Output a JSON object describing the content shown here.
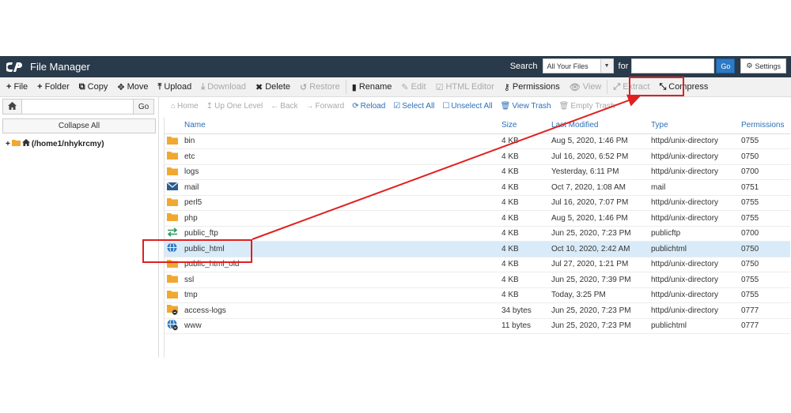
{
  "header": {
    "app_title": "File Manager",
    "search_label": "Search",
    "search_scope": "All Your Files",
    "for_label": "for",
    "search_value": "",
    "go_label": "Go",
    "settings_label": "Settings"
  },
  "toolbar": {
    "file": "File",
    "folder": "Folder",
    "copy": "Copy",
    "move": "Move",
    "upload": "Upload",
    "download": "Download",
    "delete": "Delete",
    "restore": "Restore",
    "rename": "Rename",
    "edit": "Edit",
    "html_editor": "HTML Editor",
    "permissions": "Permissions",
    "view": "View",
    "extract": "Extract",
    "compress": "Compress"
  },
  "left": {
    "go_label": "Go",
    "collapse_all": "Collapse All",
    "root_label": "(/home1/nhykrcmy)"
  },
  "nav": {
    "home": "Home",
    "up_one_level": "Up One Level",
    "back": "Back",
    "forward": "Forward",
    "reload": "Reload",
    "select_all": "Select All",
    "unselect_all": "Unselect All",
    "view_trash": "View Trash",
    "empty_trash": "Empty Trash"
  },
  "table": {
    "headers": {
      "name": "Name",
      "size": "Size",
      "last_modified": "Last Modified",
      "type": "Type",
      "permissions": "Permissions"
    },
    "rows": [
      {
        "icon": "folder-icon",
        "name": "bin",
        "size": "4 KB",
        "modified": "Aug 5, 2020, 1:46 PM",
        "type": "httpd/unix-directory",
        "perm": "0755"
      },
      {
        "icon": "folder-icon",
        "name": "etc",
        "size": "4 KB",
        "modified": "Jul 16, 2020, 6:52 PM",
        "type": "httpd/unix-directory",
        "perm": "0750"
      },
      {
        "icon": "folder-icon",
        "name": "logs",
        "size": "4 KB",
        "modified": "Yesterday, 6:11 PM",
        "type": "httpd/unix-directory",
        "perm": "0700"
      },
      {
        "icon": "mail-icon",
        "name": "mail",
        "size": "4 KB",
        "modified": "Oct 7, 2020, 1:08 AM",
        "type": "mail",
        "perm": "0751"
      },
      {
        "icon": "folder-icon",
        "name": "perl5",
        "size": "4 KB",
        "modified": "Jul 16, 2020, 7:07 PM",
        "type": "httpd/unix-directory",
        "perm": "0755"
      },
      {
        "icon": "folder-icon",
        "name": "php",
        "size": "4 KB",
        "modified": "Aug 5, 2020, 1:46 PM",
        "type": "httpd/unix-directory",
        "perm": "0755"
      },
      {
        "icon": "transfer-icon",
        "name": "public_ftp",
        "size": "4 KB",
        "modified": "Jun 25, 2020, 7:23 PM",
        "type": "publicftp",
        "perm": "0700"
      },
      {
        "icon": "globe-icon",
        "name": "public_html",
        "size": "4 KB",
        "modified": "Oct 10, 2020, 2:42 AM",
        "type": "publichtml",
        "perm": "0750",
        "selected": true
      },
      {
        "icon": "folder-icon",
        "name": "public_html_old",
        "size": "4 KB",
        "modified": "Jul 27, 2020, 1:21 PM",
        "type": "httpd/unix-directory",
        "perm": "0750"
      },
      {
        "icon": "folder-icon",
        "name": "ssl",
        "size": "4 KB",
        "modified": "Jun 25, 2020, 7:39 PM",
        "type": "httpd/unix-directory",
        "perm": "0755"
      },
      {
        "icon": "folder-icon",
        "name": "tmp",
        "size": "4 KB",
        "modified": "Today, 3:25 PM",
        "type": "httpd/unix-directory",
        "perm": "0755"
      },
      {
        "icon": "folder-link-icon",
        "name": "access-logs",
        "size": "34 bytes",
        "modified": "Jun 25, 2020, 7:23 PM",
        "type": "httpd/unix-directory",
        "perm": "0777"
      },
      {
        "icon": "globe-link-icon",
        "name": "www",
        "size": "11 bytes",
        "modified": "Jun 25, 2020, 7:23 PM",
        "type": "publichtml",
        "perm": "0777"
      }
    ]
  },
  "colors": {
    "header_bg": "#293a4a",
    "link_blue": "#2d6fb7",
    "folder": "#f0a830",
    "selected_row": "#d9ebf8",
    "annotation_red": "#e02020"
  }
}
